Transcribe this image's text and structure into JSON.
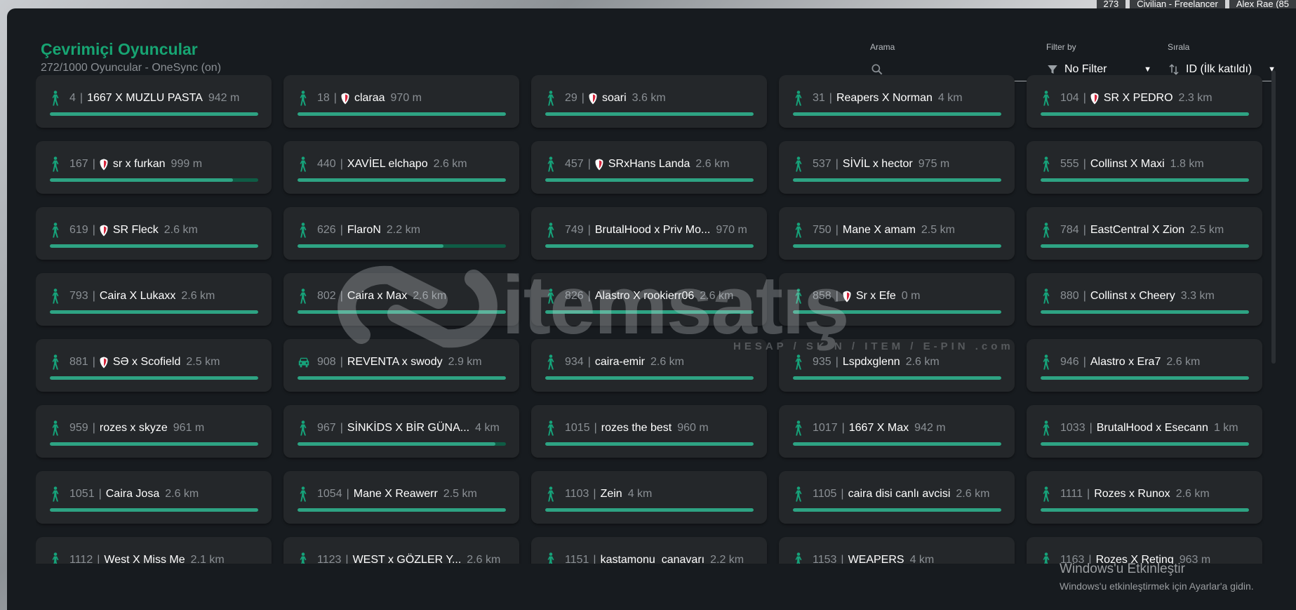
{
  "hud": {
    "players": "273",
    "job": "Civilian - Freelancer",
    "player_name": "Alex Rae (85"
  },
  "header": {
    "title": "Çevrimiçi Oyuncular",
    "subtitle": "272/1000 Oyuncular - OneSync (on)"
  },
  "search": {
    "label": "Arama",
    "value": ""
  },
  "filter": {
    "label": "Filter by",
    "value": "No Filter"
  },
  "sort": {
    "label": "Sırala",
    "value": "ID (İlk katıldı)"
  },
  "colors": {
    "accent": "#17a472",
    "bar": "#2ea383",
    "bar_track": "#0f5c45",
    "card": "#24272a",
    "panel": "#171b1f"
  },
  "players": [
    {
      "id": "4",
      "name": "1667 X MUZLU PASTA",
      "distance": "942 m",
      "icon": "walk-icon",
      "shield": false,
      "progress": 1
    },
    {
      "id": "18",
      "name": "claraa",
      "distance": "970 m",
      "icon": "walk-icon",
      "shield": true,
      "progress": 1
    },
    {
      "id": "29",
      "name": "soari",
      "distance": "3.6 km",
      "icon": "walk-icon",
      "shield": true,
      "progress": 1
    },
    {
      "id": "31",
      "name": "Reapers X Norman",
      "distance": "4 km",
      "icon": "walk-icon",
      "shield": false,
      "progress": 1
    },
    {
      "id": "104",
      "name": "SR X PEDRO",
      "distance": "2.3 km",
      "icon": "walk-icon",
      "shield": true,
      "progress": 1
    },
    {
      "id": "167",
      "name": "sr x furkan",
      "distance": "999 m",
      "icon": "walk-icon",
      "shield": true,
      "progress": 0.88
    },
    {
      "id": "440",
      "name": "XAVİEL elchapo",
      "distance": "2.6 km",
      "icon": "walk-icon",
      "shield": false,
      "progress": 1
    },
    {
      "id": "457",
      "name": "SRxHans Landa",
      "distance": "2.6 km",
      "icon": "walk-icon",
      "shield": true,
      "progress": 1
    },
    {
      "id": "537",
      "name": "SİVİL x hector",
      "distance": "975 m",
      "icon": "walk-icon",
      "shield": false,
      "progress": 1
    },
    {
      "id": "555",
      "name": "Collinst X Maxi",
      "distance": "1.8 km",
      "icon": "walk-icon",
      "shield": false,
      "progress": 1
    },
    {
      "id": "619",
      "name": "SR Fleck",
      "distance": "2.6 km",
      "icon": "walk-icon",
      "shield": true,
      "progress": 1
    },
    {
      "id": "626",
      "name": "FlaroN",
      "distance": "2.2 km",
      "icon": "walk-icon",
      "shield": false,
      "progress": 0.7
    },
    {
      "id": "749",
      "name": "BrutalHood x Priv Mo...",
      "distance": "970 m",
      "icon": "walk-icon",
      "shield": false,
      "progress": 1
    },
    {
      "id": "750",
      "name": "Mane X amam",
      "distance": "2.5 km",
      "icon": "walk-icon",
      "shield": false,
      "progress": 1
    },
    {
      "id": "784",
      "name": "EastCentral X Zion",
      "distance": "2.5 km",
      "icon": "walk-icon",
      "shield": false,
      "progress": 1
    },
    {
      "id": "793",
      "name": "Caira X Lukaxx",
      "distance": "2.6 km",
      "icon": "walk-icon",
      "shield": false,
      "progress": 1
    },
    {
      "id": "802",
      "name": "Caira x Max",
      "distance": "2.6 km",
      "icon": "walk-icon",
      "shield": false,
      "progress": 1
    },
    {
      "id": "826",
      "name": "Alastro X rookierr06",
      "distance": "2.6 km",
      "icon": "walk-icon",
      "shield": false,
      "progress": 1
    },
    {
      "id": "858",
      "name": "Sr x Efe",
      "distance": "0 m",
      "icon": "walk-icon",
      "shield": true,
      "progress": 1
    },
    {
      "id": "880",
      "name": "Collinst x Cheery",
      "distance": "3.3 km",
      "icon": "walk-icon",
      "shield": false,
      "progress": 1
    },
    {
      "id": "881",
      "name": "SƏ x Scofield",
      "distance": "2.5 km",
      "icon": "walk-icon",
      "shield": true,
      "progress": 1
    },
    {
      "id": "908",
      "name": "REVENTA x swody",
      "distance": "2.9 km",
      "icon": "car-icon",
      "shield": false,
      "progress": 1
    },
    {
      "id": "934",
      "name": "caira-emir",
      "distance": "2.6 km",
      "icon": "walk-icon",
      "shield": false,
      "progress": 1
    },
    {
      "id": "935",
      "name": "Lspdxglenn",
      "distance": "2.6 km",
      "icon": "walk-icon",
      "shield": false,
      "progress": 1
    },
    {
      "id": "946",
      "name": "Alastro x Era7",
      "distance": "2.6 km",
      "icon": "walk-icon",
      "shield": false,
      "progress": 1
    },
    {
      "id": "959",
      "name": "rozes x skyze",
      "distance": "961 m",
      "icon": "walk-icon",
      "shield": false,
      "progress": 1
    },
    {
      "id": "967",
      "name": "SİNKİDS X BİR GÜNA...",
      "distance": "4 km",
      "icon": "walk-icon",
      "shield": false,
      "progress": 0.95
    },
    {
      "id": "1015",
      "name": "rozes the best",
      "distance": "960 m",
      "icon": "walk-icon",
      "shield": false,
      "progress": 1
    },
    {
      "id": "1017",
      "name": "1667 X Max",
      "distance": "942 m",
      "icon": "walk-icon",
      "shield": false,
      "progress": 1
    },
    {
      "id": "1033",
      "name": "BrutalHood x Esecann",
      "distance": "1 km",
      "icon": "walk-icon",
      "shield": false,
      "progress": 1
    },
    {
      "id": "1051",
      "name": "Caira Josa",
      "distance": "2.6 km",
      "icon": "walk-icon",
      "shield": false,
      "progress": 1
    },
    {
      "id": "1054",
      "name": "Mane X Reawerr",
      "distance": "2.5 km",
      "icon": "walk-icon",
      "shield": false,
      "progress": 1
    },
    {
      "id": "1103",
      "name": "Zein",
      "distance": "4 km",
      "icon": "walk-icon",
      "shield": false,
      "progress": 1
    },
    {
      "id": "1105",
      "name": "caira disi canlı avcisi",
      "distance": "2.6 km",
      "icon": "walk-icon",
      "shield": false,
      "progress": 1
    },
    {
      "id": "1111",
      "name": "Rozes x Runox",
      "distance": "2.6 km",
      "icon": "walk-icon",
      "shield": false,
      "progress": 1
    },
    {
      "id": "1112",
      "name": "West X Miss Me",
      "distance": "2.1 km",
      "icon": "walk-icon",
      "shield": false,
      "progress": 1
    },
    {
      "id": "1123",
      "name": "WEST x GÖZLER Y...",
      "distance": "2.6 km",
      "icon": "walk-icon",
      "shield": false,
      "progress": 1
    },
    {
      "id": "1151",
      "name": "kastamonu_canavarı",
      "distance": "2.2 km",
      "icon": "walk-icon",
      "shield": false,
      "progress": 1
    },
    {
      "id": "1153",
      "name": "WEAPERS",
      "distance": "4 km",
      "icon": "walk-icon",
      "shield": false,
      "progress": 1
    },
    {
      "id": "1163",
      "name": "Rozes X Reting",
      "distance": "963 m",
      "icon": "walk-icon",
      "shield": false,
      "progress": 1
    }
  ],
  "watermark": {
    "brand": "itemsatış",
    "tagline": "HESAP / SKIN / ITEM / E-PIN .com"
  },
  "windows_activation": {
    "title": "Windows'u Etkinleştir",
    "message": "Windows'u etkinleştirmek için Ayarlar'a gidin."
  }
}
